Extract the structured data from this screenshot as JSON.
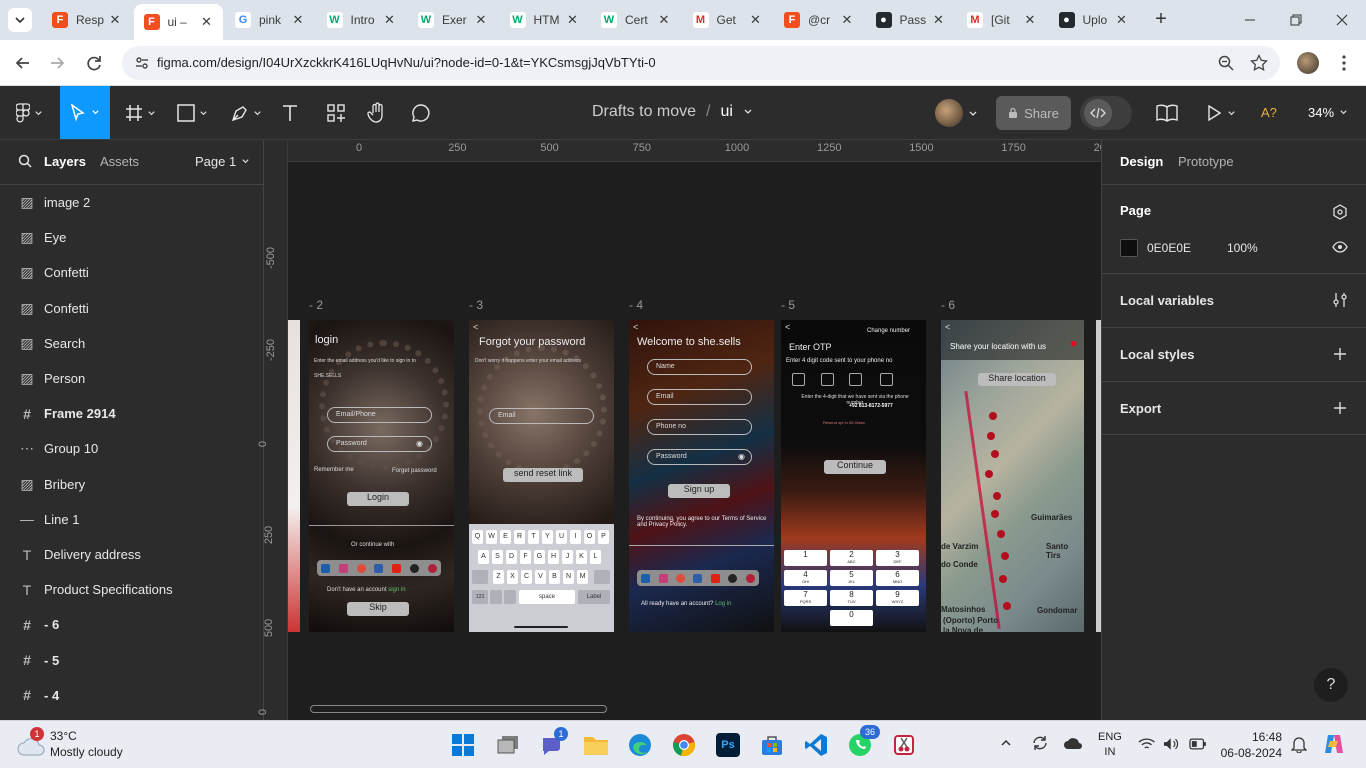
{
  "browser": {
    "tabs": [
      {
        "title": "Resp",
        "favicon": "figma-icon",
        "active": false
      },
      {
        "title": "ui –",
        "favicon": "figma-icon",
        "active": true
      },
      {
        "title": "pink",
        "favicon": "google-icon",
        "active": false
      },
      {
        "title": "Intro",
        "favicon": "w3schools-icon",
        "active": false
      },
      {
        "title": "Exer",
        "favicon": "w3schools-icon",
        "active": false
      },
      {
        "title": "HTM",
        "favicon": "w3schools-icon",
        "active": false
      },
      {
        "title": "Cert",
        "favicon": "w3schools-icon",
        "active": false
      },
      {
        "title": "Get",
        "favicon": "gmail-icon",
        "active": false
      },
      {
        "title": "@cr",
        "favicon": "figma-icon",
        "active": false
      },
      {
        "title": "Pass",
        "favicon": "github-icon",
        "active": false
      },
      {
        "title": "[Git",
        "favicon": "gmail-icon",
        "active": false
      },
      {
        "title": "Uplo",
        "favicon": "github-icon",
        "active": false
      }
    ],
    "url": "figma.com/design/I04UrXzckkrK416LUqHvNu/ui?node-id=0-1&t=YKCsmsgjJqVbTYti-0"
  },
  "toolbar": {
    "breadcrumb_project": "Drafts to move",
    "breadcrumb_sep": "/",
    "file_name": "ui",
    "share_label": "Share",
    "zoom": "34%",
    "ai_label": "A?"
  },
  "left_panel": {
    "tabs": {
      "layers": "Layers",
      "assets": "Assets"
    },
    "page_selector": "Page 1",
    "layers": [
      {
        "name": "image 2",
        "icon": "image-icon",
        "bold": false
      },
      {
        "name": "Eye",
        "icon": "image-icon",
        "bold": false
      },
      {
        "name": "Confetti",
        "icon": "image-icon",
        "bold": false
      },
      {
        "name": "Confetti",
        "icon": "image-icon",
        "bold": false
      },
      {
        "name": "Search",
        "icon": "image-icon",
        "bold": false
      },
      {
        "name": "Person",
        "icon": "image-icon",
        "bold": false
      },
      {
        "name": "Frame 2914",
        "icon": "frame-icon",
        "bold": true
      },
      {
        "name": "Group 10",
        "icon": "group-icon",
        "bold": false
      },
      {
        "name": "Bribery",
        "icon": "image-icon",
        "bold": false
      },
      {
        "name": "Line 1",
        "icon": "line-icon",
        "bold": false
      },
      {
        "name": "Delivery address",
        "icon": "text-icon",
        "bold": false
      },
      {
        "name": "Product Specifications",
        "icon": "text-icon",
        "bold": false
      },
      {
        "name": "- 6",
        "icon": "frame-icon",
        "bold": true
      },
      {
        "name": "- 5",
        "icon": "frame-icon",
        "bold": true
      },
      {
        "name": "- 4",
        "icon": "frame-icon",
        "bold": true
      }
    ]
  },
  "canvas": {
    "ruler_top": [
      "0",
      "250",
      "500",
      "750",
      "1000",
      "1250",
      "1500",
      "1750",
      "20"
    ],
    "ruler_left": [
      "-500",
      "-250",
      "0",
      "250",
      "500",
      "0"
    ],
    "frame_labels": [
      "- 2",
      "- 3",
      "- 4",
      "- 5",
      "- 6"
    ],
    "frames": {
      "login": {
        "title": "login",
        "subtitle": "Enter the email address you'd like to sign in to",
        "brand": "SHE.SELLS",
        "email": "Email/Phone",
        "password": "Password",
        "remember": "Remember me",
        "forgot": "Forget password",
        "login_btn": "Login",
        "or": "Or continue with",
        "no_account": "Don't have an account",
        "sign_in": "sign in",
        "skip": "Skip"
      },
      "forgot": {
        "title": "Forgot your password",
        "subtitle": "Don't worry it happens enter your email address",
        "email": "Email",
        "reset_btn": "send reset link",
        "keys_row1": [
          "Q",
          "W",
          "E",
          "R",
          "T",
          "Y",
          "U",
          "I",
          "O",
          "P"
        ],
        "keys_row2": [
          "A",
          "S",
          "D",
          "F",
          "G",
          "H",
          "J",
          "K",
          "L"
        ],
        "keys_row3": [
          "Z",
          "X",
          "C",
          "V",
          "B",
          "N",
          "M"
        ],
        "space": "space",
        "label": "Label",
        "num": "123"
      },
      "signup": {
        "title": "Welcome to she.sells",
        "name": "Name",
        "email": "Email",
        "phone": "Phone no",
        "password": "Password",
        "signup_btn": "Sign up",
        "terms": "By continuing, you agree to our Terms of Service and Privacy Policy.",
        "already": "All ready have an account?",
        "login": "Log in"
      },
      "otp": {
        "change": "Change number",
        "title": "Enter OTP",
        "subtitle": "Enter 4 digit code sent to your phone no",
        "info": "Enter the 4-digit that we have sent via the phone number",
        "phone": "+92 813-8172-5977",
        "resend": "Resend opt in 00:30sec",
        "continue_btn": "Continue",
        "keys": [
          "1",
          "2",
          "3",
          "4",
          "5",
          "6",
          "7",
          "8",
          "9",
          "0"
        ],
        "keysub": [
          "",
          "ABC",
          "DEF",
          "GHI",
          "JKL",
          "MNO",
          "PQRS",
          "TUV",
          "WXYZ",
          ""
        ]
      },
      "location": {
        "title": "Share your location with us",
        "share_btn": "Share location",
        "places": [
          "de Varzim",
          "do Conde",
          "Matosinhos",
          "(Oporto) Porto",
          "la Nova de",
          "Guimarães",
          "Santo Tirs",
          "Gondomar"
        ]
      }
    }
  },
  "right_panel": {
    "tabs": {
      "design": "Design",
      "prototype": "Prototype"
    },
    "page_title": "Page",
    "bg_hex": "0E0E0E",
    "bg_opacity": "100%",
    "local_variables": "Local variables",
    "local_styles": "Local styles",
    "export": "Export"
  },
  "taskbar": {
    "weather_temp": "33°C",
    "weather_desc": "Mostly cloudy",
    "weather_badge": "1",
    "teams_badge": "1",
    "whatsapp_badge": "36",
    "lang1": "ENG",
    "lang2": "IN",
    "time": "16:48",
    "date": "06-08-2024"
  },
  "colors": {
    "figma_accent": "#0d99ff",
    "canvas_bg": "#1e1e1e",
    "page_bg": "#0E0E0E"
  }
}
